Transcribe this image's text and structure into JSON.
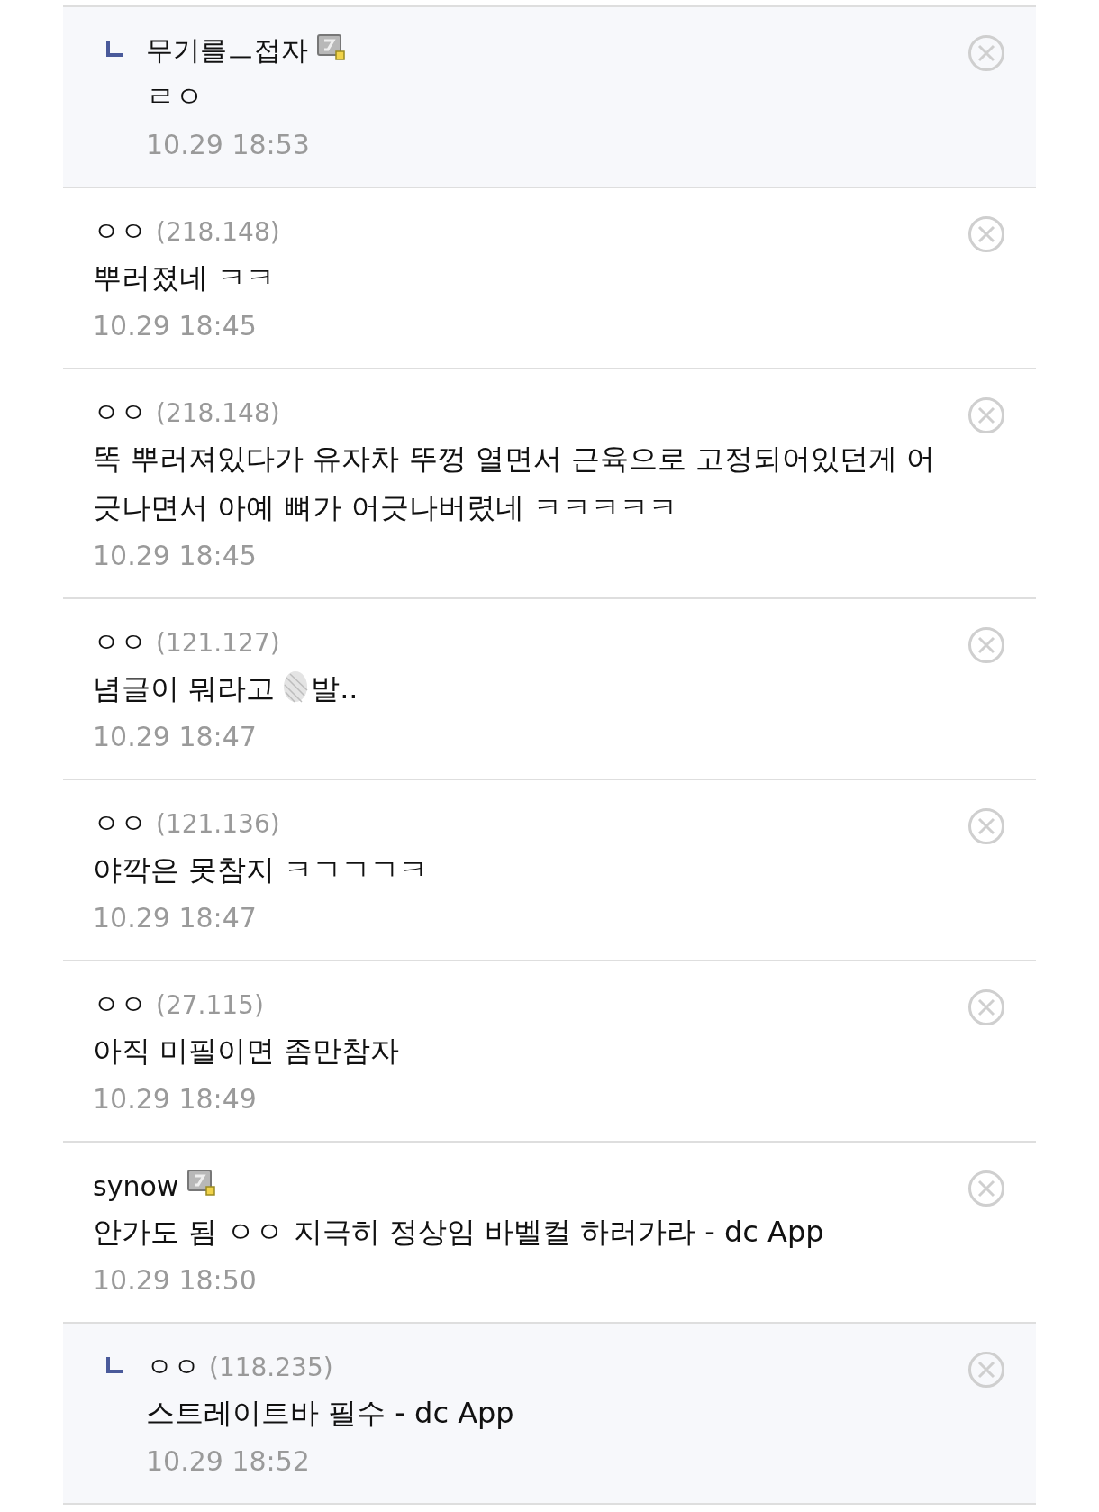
{
  "comments": [
    {
      "kind": "reply",
      "name": "무기를ㅡ접자",
      "fixed_nick": true,
      "body": "ㄹㅇ",
      "censor": false,
      "date": "10.29 18:53"
    },
    {
      "kind": "comment",
      "name": "ㅇㅇ",
      "ip": "(218.148)",
      "fixed_nick": false,
      "body": "뿌러졌네 ㅋㅋ",
      "censor": false,
      "date": "10.29 18:45"
    },
    {
      "kind": "comment",
      "name": "ㅇㅇ",
      "ip": "(218.148)",
      "fixed_nick": false,
      "body": "똑 뿌러져있다가 유자차 뚜껑 열면서 근육으로 고정되어있던게 어긋나면서 아예 뼈가 어긋나버렸네 ㅋㅋㅋㅋㅋ",
      "censor": false,
      "date": "10.29 18:45"
    },
    {
      "kind": "comment",
      "name": "ㅇㅇ",
      "ip": "(121.127)",
      "fixed_nick": false,
      "body": "념글이 뭐라고",
      "censor": true,
      "body_tail": "발..",
      "date": "10.29 18:47"
    },
    {
      "kind": "comment",
      "name": "ㅇㅇ",
      "ip": "(121.136)",
      "fixed_nick": false,
      "body": "야깍은 못참지 ㅋㄱㄱㄱㅋ",
      "censor": false,
      "date": "10.29 18:47"
    },
    {
      "kind": "comment",
      "name": "ㅇㅇ",
      "ip": "(27.115)",
      "fixed_nick": false,
      "body": "아직 미필이면 좀만참자",
      "censor": false,
      "date": "10.29 18:49"
    },
    {
      "kind": "comment",
      "name": "synow",
      "fixed_nick": true,
      "body": "안가도 됨 ㅇㅇ 지극히 정상임 바벨컬 하러가라 - dc App",
      "censor": false,
      "date": "10.29 18:50"
    },
    {
      "kind": "reply",
      "name": "ㅇㅇ",
      "ip": "(118.235)",
      "fixed_nick": false,
      "body": "스트레이트바 필수 - dc App",
      "censor": false,
      "date": "10.29 18:52"
    }
  ]
}
